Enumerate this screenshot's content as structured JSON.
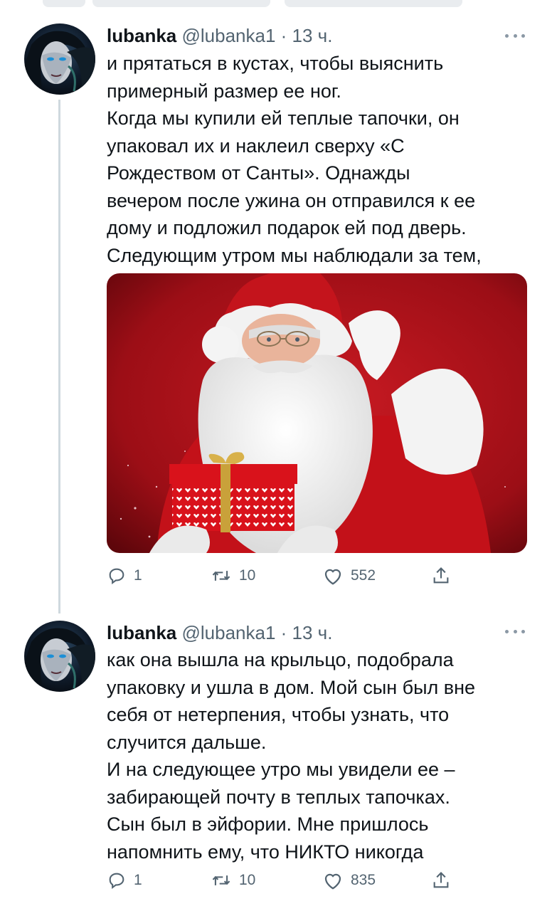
{
  "tweets": [
    {
      "author_name": "lubanka",
      "author_handle": "@lubanka1",
      "separator": " · ",
      "time": "13 ч.",
      "lines": [
        "и прятаться в кустах, чтобы выяснить",
        "примерный размер ее ног.",
        "Когда мы купили ей теплые тапочки, он",
        "упаковал их и наклеил сверху «С",
        "Рождеством от Санты». Однажды",
        "вечером после ужина он отправился к ее",
        "дому и подложил подарок ей под дверь.",
        "Следующим утром мы наблюдали за тем,"
      ],
      "has_media": true,
      "replies": "1",
      "retweets": "10",
      "likes": "552"
    },
    {
      "author_name": "lubanka",
      "author_handle": "@lubanka1",
      "separator": " · ",
      "time": "13 ч.",
      "lines": [
        "как она вышла на крыльцо, подобрала",
        "упаковку и ушла в дом. Мой сын был вне",
        "себя от нетерпения, чтобы узнать, что",
        "случится дальше.",
        "И на следующее утро мы увидели ее –",
        "забирающей почту в теплых тапочках.",
        "Сын был в эйфории. Мне пришлось",
        "напомнить ему, что НИКТО никогда"
      ],
      "has_media": false,
      "replies": "1",
      "retweets": "10",
      "likes": "835"
    }
  ],
  "icons": {
    "avatar": "dark-avatar-face",
    "more": "more-dots-icon",
    "reply": "reply-icon",
    "retweet": "retweet-icon",
    "like": "heart-icon",
    "share": "share-icon"
  },
  "colors": {
    "text": "#0f1419",
    "secondary": "#536471",
    "thread_line": "#cfd9de",
    "santa_bg": "#b5121b"
  }
}
